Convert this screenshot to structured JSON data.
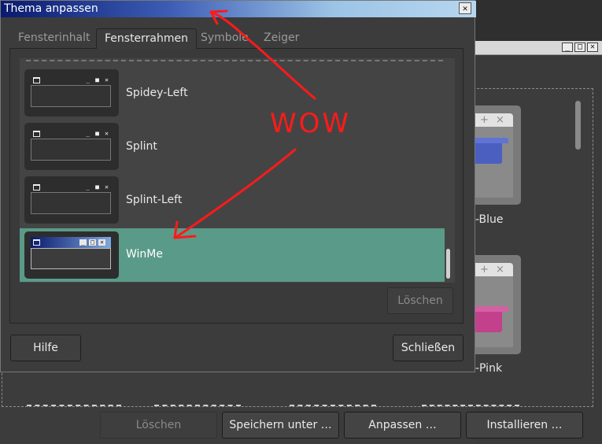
{
  "dialog": {
    "title": "Thema anpassen",
    "close_glyph": "✕",
    "tabs": [
      {
        "label": "Fensterinhalt",
        "active": false
      },
      {
        "label": "Fensterrahmen",
        "active": true
      },
      {
        "label": "Symbole",
        "active": false
      },
      {
        "label": "Zeiger",
        "active": false
      }
    ],
    "themes": [
      {
        "name": "Spidey-Left",
        "selected": false
      },
      {
        "name": "Splint",
        "selected": false
      },
      {
        "name": "Splint-Left",
        "selected": false
      },
      {
        "name": "WinMe",
        "selected": true
      }
    ],
    "delete_button": "Löschen",
    "help_button": "Hilfe",
    "close_button": "Schließen"
  },
  "background_window": {
    "controls": [
      "_",
      "□",
      "✕"
    ],
    "theme_labels": [
      "-Blue",
      "-Pink"
    ],
    "buttons": [
      {
        "label": "Löschen",
        "enabled": false
      },
      {
        "label": "Speichern unter …",
        "enabled": true
      },
      {
        "label": "Anpassen …",
        "enabled": true
      },
      {
        "label": "Installieren …",
        "enabled": true
      }
    ]
  },
  "annotation": {
    "text": "WOW",
    "color": "#ff1a1a"
  },
  "colors": {
    "selection": "#5a9a88",
    "folder_blue": "#4a5fc0",
    "folder_pink": "#c2408c"
  }
}
